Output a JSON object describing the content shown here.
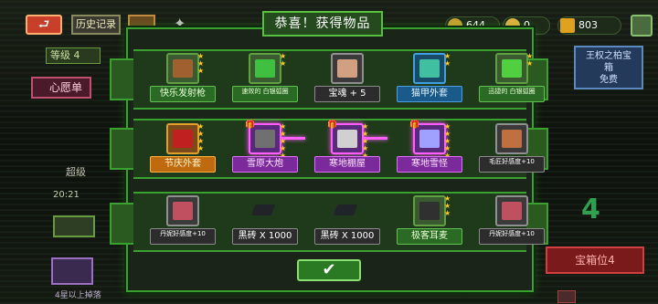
{
  "topbar": {
    "back_icon": "back-arrow-icon",
    "history_label": "历史记录",
    "currencies": [
      {
        "name": "gems",
        "value": "644",
        "color": "#c8a030"
      },
      {
        "name": "keys",
        "value": "0",
        "color": "#e0b040"
      },
      {
        "name": "gold",
        "value": "803",
        "color": "#e0a020"
      }
    ]
  },
  "background": {
    "level_label": "等级 4",
    "wish_list_label": "心愿单",
    "super_label": "超级",
    "timer_label": "20:21",
    "bottom_left_label": "4星以上掉落",
    "king_chest_line1": "王权之柏宝",
    "king_chest_line2": "箱",
    "king_chest_line3": "免费",
    "big_number": "4",
    "chest_btn_label": "宝箱位4"
  },
  "dialog": {
    "title": "恭喜！获得物品",
    "rows": [
      {
        "items": [
          {
            "label": "快乐发射枪",
            "style": "green",
            "slot": "green",
            "art_color": "#a06030",
            "stars": 3,
            "icon": "gun-icon"
          },
          {
            "label": "速效的 白银弧圈",
            "style": "green",
            "slot": "green",
            "art_color": "#40c040",
            "stars": 2,
            "small": true,
            "icon": "ring-icon"
          },
          {
            "label": "宝魂 + 5",
            "style": "gray",
            "slot": "gray",
            "art_color": "#d0a080",
            "stars": 0,
            "icon": "heart-badge-icon"
          },
          {
            "label": "猫甲外套",
            "style": "blue",
            "slot": "blue",
            "art_color": "#40c0a0",
            "stars": 2,
            "icon": "armor-icon"
          },
          {
            "label": "迅捷的 白银弧圈",
            "style": "green",
            "slot": "green",
            "art_color": "#50d040",
            "stars": 2,
            "small": true,
            "icon": "ring-icon"
          }
        ]
      },
      {
        "items": [
          {
            "label": "节庆外套",
            "style": "gold",
            "slot": "gold",
            "art_color": "#c02020",
            "stars": 4,
            "icon": "coat-icon"
          },
          {
            "label": "雪原大炮",
            "style": "purple",
            "slot": "purple",
            "art_color": "#707070",
            "stars": 5,
            "icon": "cannon-icon",
            "new": true
          },
          {
            "label": "寒地棚屋",
            "style": "purple",
            "slot": "purple",
            "art_color": "#d0d0d0",
            "stars": 5,
            "icon": "hut-icon",
            "new": true
          },
          {
            "label": "寒地雪怪",
            "style": "purple",
            "slot": "purple",
            "art_color": "#a0a0ff",
            "stars": 5,
            "icon": "yeti-icon",
            "new": true
          },
          {
            "label": "毛匠好感度+10",
            "style": "gray",
            "slot": "gray",
            "art_color": "#c07040",
            "stars": 0,
            "small": true,
            "icon": "character-face-icon"
          }
        ]
      },
      {
        "items": [
          {
            "label": "丹妮好感度+10",
            "style": "gray",
            "slot": "gray",
            "art_color": "#c05060",
            "stars": 0,
            "small": true,
            "icon": "character-face-icon"
          },
          {
            "label": "黑砖 X 1000",
            "style": "gray",
            "slot": "none",
            "art_color": "#202428",
            "stars": 0,
            "icon": "black-brick-icon"
          },
          {
            "label": "黑砖 X 1000",
            "style": "gray",
            "slot": "none",
            "art_color": "#202428",
            "stars": 0,
            "icon": "black-brick-icon"
          },
          {
            "label": "极客耳麦",
            "style": "green",
            "slot": "green",
            "art_color": "#303030",
            "stars": 3,
            "icon": "headset-icon"
          },
          {
            "label": "丹妮好感度+10",
            "style": "gray",
            "slot": "gray",
            "art_color": "#c05060",
            "stars": 0,
            "small": true,
            "icon": "character-face-icon"
          }
        ]
      }
    ],
    "confirm_icon": "checkmark-icon",
    "confirm_label": "✔"
  }
}
